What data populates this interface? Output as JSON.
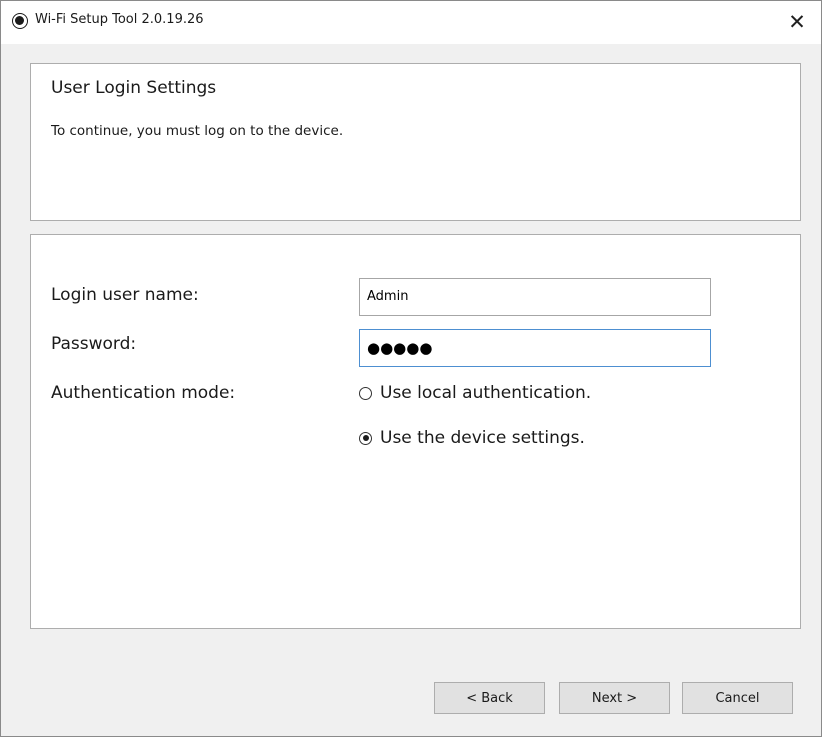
{
  "window": {
    "title": "Wi-Fi Setup Tool 2.0.19.26",
    "close_glyph": "✕"
  },
  "header": {
    "title": "User Login Settings",
    "description": "To continue, you must log on to the device."
  },
  "form": {
    "username_label": "Login user name:",
    "username_value": "Admin",
    "password_label": "Password:",
    "password_masked": "●●●●●",
    "auth_label": "Authentication mode:",
    "auth_options": [
      {
        "label": "Use local authentication.",
        "selected": false
      },
      {
        "label": "Use the device settings.",
        "selected": true
      }
    ]
  },
  "buttons": {
    "back": "< Back",
    "next": "Next >",
    "cancel": "Cancel"
  }
}
